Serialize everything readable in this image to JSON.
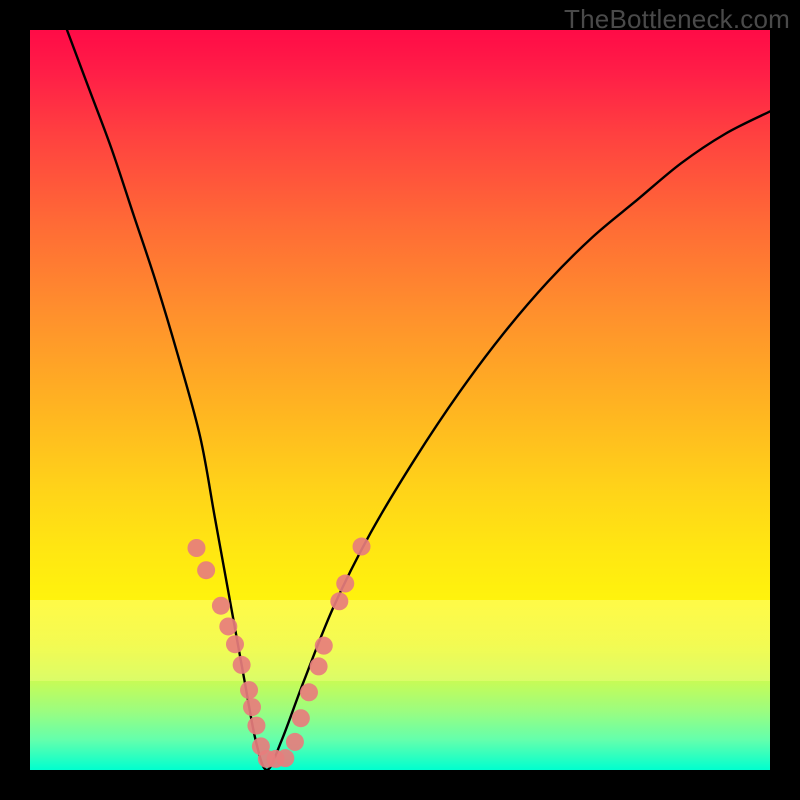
{
  "watermark": "TheBottleneck.com",
  "chart_data": {
    "type": "line",
    "title": "",
    "xlabel": "",
    "ylabel": "",
    "xlim": [
      0,
      100
    ],
    "ylim": [
      0,
      100
    ],
    "grid": false,
    "legend": false,
    "series": [
      {
        "name": "bottleneck-curve",
        "x": [
          5,
          8,
          11,
          14,
          17,
          20,
          23,
          25,
          27,
          29,
          30.5,
          32,
          34,
          37,
          41,
          46,
          52,
          58,
          64,
          70,
          76,
          82,
          88,
          94,
          100
        ],
        "y_pct": [
          100,
          92,
          84,
          75,
          66,
          56,
          45,
          34,
          23,
          12,
          4,
          0,
          4,
          12,
          22,
          32,
          42,
          51,
          59,
          66,
          72,
          77,
          82,
          86,
          89
        ]
      }
    ],
    "markers": {
      "name": "highlight-points",
      "color": "#e77d7d",
      "radius_px": 9,
      "points_xpct_ypct": [
        [
          22.5,
          30.0
        ],
        [
          23.8,
          27.0
        ],
        [
          25.8,
          22.2
        ],
        [
          26.8,
          19.4
        ],
        [
          27.7,
          17.0
        ],
        [
          28.6,
          14.2
        ],
        [
          29.6,
          10.8
        ],
        [
          30.0,
          8.5
        ],
        [
          30.6,
          6.0
        ],
        [
          31.2,
          3.2
        ],
        [
          32.0,
          1.5
        ],
        [
          33.2,
          1.5
        ],
        [
          34.5,
          1.6
        ],
        [
          35.8,
          3.8
        ],
        [
          36.6,
          7.0
        ],
        [
          37.7,
          10.5
        ],
        [
          39.0,
          14.0
        ],
        [
          39.7,
          16.8
        ],
        [
          41.8,
          22.8
        ],
        [
          42.6,
          25.2
        ],
        [
          44.8,
          30.2
        ]
      ]
    },
    "background_gradient_stops": [
      {
        "pct": 0,
        "color": "#ff0b47"
      },
      {
        "pct": 14,
        "color": "#ff4040"
      },
      {
        "pct": 38,
        "color": "#ff8f2d"
      },
      {
        "pct": 62,
        "color": "#ffd319"
      },
      {
        "pct": 77,
        "color": "#fff30d"
      },
      {
        "pct": 92,
        "color": "#9cfd7f"
      },
      {
        "pct": 100,
        "color": "#00ffcf"
      }
    ]
  }
}
